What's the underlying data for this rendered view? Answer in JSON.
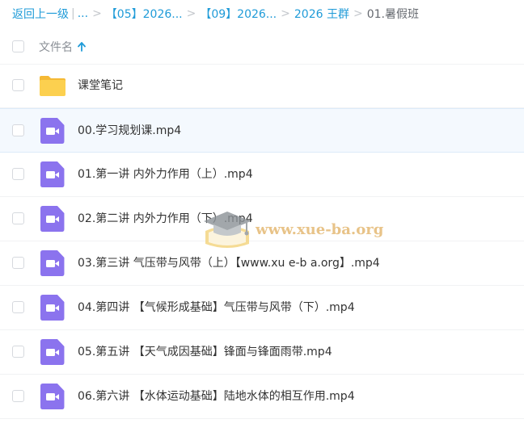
{
  "breadcrumb": {
    "back_label": "返回上一级",
    "divider": "|",
    "ellipsis": "...",
    "separator": ">",
    "crumbs": [
      "【05】2026...",
      "【09】2026...",
      "2026 王群"
    ],
    "current": "01.暑假班"
  },
  "list_header": {
    "name_label": "文件名",
    "sort": "ascending"
  },
  "files": [
    {
      "type": "folder",
      "name": "课堂笔记",
      "icon": "folder-icon",
      "color": "#fcd04f"
    },
    {
      "type": "video",
      "name": "00.学习规划课.mp4",
      "icon": "video-file-icon",
      "color": "#8b73ee",
      "selected": true
    },
    {
      "type": "video",
      "name": "01.第一讲 内外力作用（上）.mp4",
      "icon": "video-file-icon",
      "color": "#8b73ee"
    },
    {
      "type": "video",
      "name": "02.第二讲 内外力作用（下）.mp4",
      "icon": "video-file-icon",
      "color": "#8b73ee"
    },
    {
      "type": "video",
      "name": "03.第三讲 气压带与风带（上）【www.xu e-b a.org】.mp4",
      "icon": "video-file-icon",
      "color": "#8b73ee"
    },
    {
      "type": "video",
      "name": "04.第四讲 【气候形成基础】气压带与风带（下）.mp4",
      "icon": "video-file-icon",
      "color": "#8b73ee"
    },
    {
      "type": "video",
      "name": "05.第五讲 【天气成因基础】锋面与锋面雨带.mp4",
      "icon": "video-file-icon",
      "color": "#8b73ee"
    },
    {
      "type": "video",
      "name": "06.第六讲 【水体运动基础】陆地水体的相互作用.mp4",
      "icon": "video-file-icon",
      "color": "#8b73ee"
    }
  ],
  "watermark": {
    "text": "www.xue-ba.org",
    "icon": "graduation-cap-icon"
  },
  "colors": {
    "link": "#1f9bd8",
    "selected_row": "#f4f9fe"
  }
}
